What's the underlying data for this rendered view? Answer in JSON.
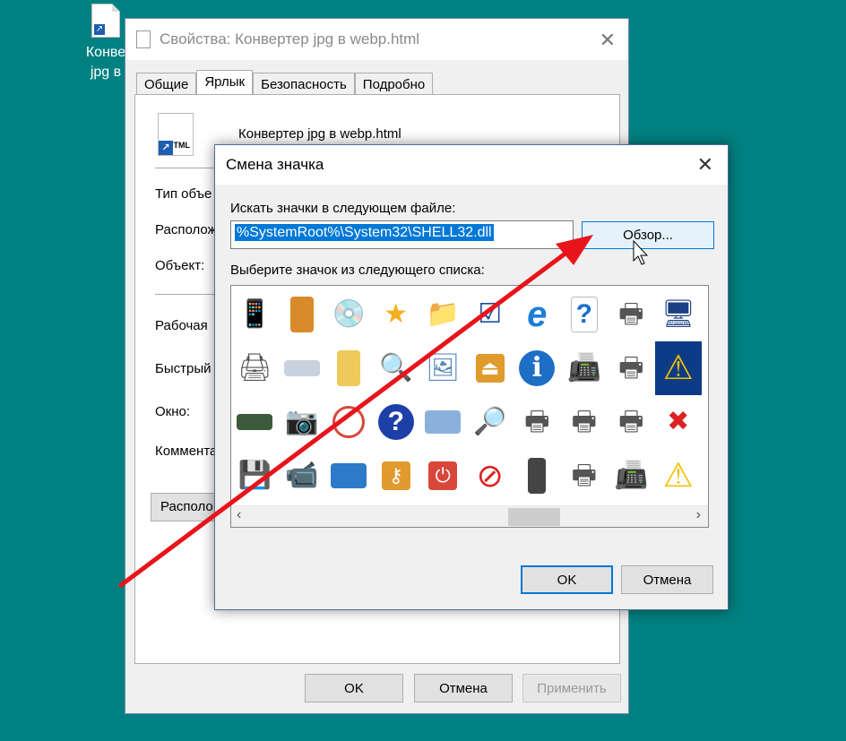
{
  "desktop": {
    "icon_line1": "Конве",
    "icon_line2": "jpg в"
  },
  "properties": {
    "title": "Свойства: Конвертер jpg в webp.html",
    "tabs": [
      "Общие",
      "Ярлык",
      "Безопасность",
      "Подробно"
    ],
    "file_name": "Конвертер jpg в webp.html",
    "icon_text": "TML",
    "labels": {
      "type": "Тип объе",
      "location": "Располож",
      "target": "Объект:",
      "workdir": "Рабочая",
      "shortcut": "Быстрый",
      "window": "Окно:",
      "comment": "Коммента"
    },
    "location_button": "Располо",
    "ok": "OK",
    "cancel": "Отмена",
    "apply": "Применить"
  },
  "change_icon": {
    "title": "Смена значка",
    "search_label": "Искать значки в следующем файле:",
    "path_value": "%SystemRoot%\\System32\\SHELL32.dll",
    "browse": "Обзор...",
    "list_label": "Выберите значок из следующего списка:",
    "ok": "OK",
    "cancel": "Отмена",
    "icons": [
      [
        "mobile-phone-icon",
        "pda-icon",
        "dvd-rw-icon",
        "star-icon",
        "folder-calendar-icon",
        "document-check-icon",
        "internet-explorer-icon",
        "help-document-icon",
        "printer-network-icon",
        "computer-screen-icon",
        "warning-partial-icon"
      ],
      [
        "network-printer-icon",
        "scanner-icon",
        "folder-icon",
        "magnifier-icon",
        "images-document-icon",
        "eject-icon",
        "info-icon",
        "fax-icon",
        "printer-network2-icon",
        "warning-selected-icon",
        "warning-partial2-icon"
      ],
      [
        "drive-green-icon",
        "camera-scanner-icon",
        "disc-red-icon",
        "help-circle-icon",
        "screen-blue-icon",
        "folder-search-icon",
        "printer-check-icon",
        "printer-search-icon",
        "printer-users-icon",
        "document-delete-icon",
        "share-partial-icon"
      ],
      [
        "drive-floppy-icon",
        "camcorder-icon",
        "control-panel-icon",
        "key-icon",
        "power-icon",
        "no-entry-icon",
        "server-check-icon",
        "printer-edit-icon",
        "fax-machine-icon",
        "warning-icon",
        "arrow-partial-icon"
      ]
    ]
  }
}
